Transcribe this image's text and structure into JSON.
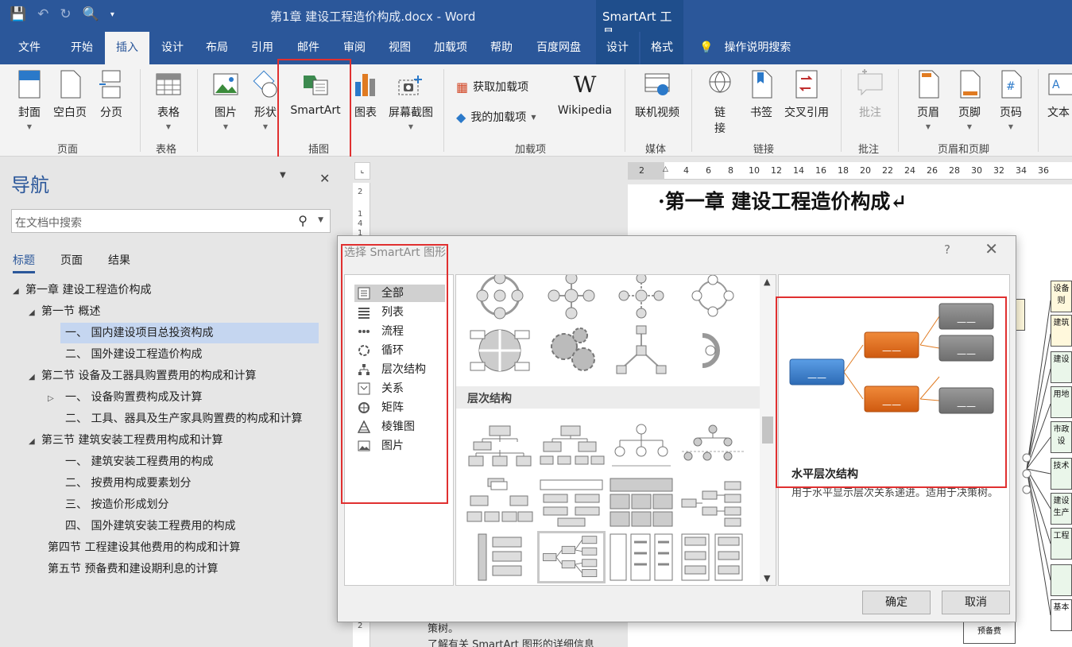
{
  "titlebar": {
    "doc_title": "第1章 建设工程造价构成.docx  -  Word",
    "tools_tab": "SmartArt 工具"
  },
  "tabs": [
    "文件",
    "开始",
    "插入",
    "设计",
    "布局",
    "引用",
    "邮件",
    "审阅",
    "视图",
    "加载项",
    "帮助",
    "百度网盘"
  ],
  "tool_tabs": [
    "设计",
    "格式"
  ],
  "search_tab": "操作说明搜索",
  "ribbon": {
    "page": {
      "cover": "封面",
      "blank": "空白页",
      "break": "分页",
      "group": "页面"
    },
    "table": {
      "table": "表格",
      "group": "表格"
    },
    "illus": {
      "picture": "图片",
      "shapes": "形状",
      "smartart": "SmartArt",
      "chart": "图表",
      "screenshot": "屏幕截图",
      "group": "插图"
    },
    "addins": {
      "get": "获取加载项",
      "mine": "我的加载项",
      "wiki": "Wikipedia",
      "wiki_logo": "W",
      "group": "加载项"
    },
    "media": {
      "video": "联机视频",
      "group": "媒体"
    },
    "links": {
      "link_a": "链",
      "link_b": "接",
      "bookmark": "书签",
      "cross": "交叉引用",
      "group": "链接"
    },
    "comments": {
      "comment": "批注",
      "group": "批注"
    },
    "hf": {
      "header": "页眉",
      "footer": "页脚",
      "pagenum": "页码",
      "group": "页眉和页脚"
    },
    "text": {
      "textbox": "文本"
    }
  },
  "nav": {
    "title": "导航",
    "search_placeholder": "在文档中搜索",
    "tabs": [
      "标题",
      "页面",
      "结果"
    ],
    "items": [
      "第一章 建设工程造价构成",
      "第一节 概述",
      "一、 国内建设项目总投资构成",
      "二、 国外建设工程造价构成",
      "第二节 设备及工器具购置费用的构成和计算",
      "一、 设备购置费构成及计算",
      "二、 工具、器具及生产家具购置费的构成和计算",
      "第三节 建筑安装工程费用构成和计算",
      "一、 建筑安装工程费用的构成",
      "二、 按费用构成要素划分",
      "三、 按造价形成划分",
      "四、 国外建筑安装工程费用的构成",
      "第四节 工程建设其他费用的构成和计算",
      "第五节 预备费和建设期利息的计算"
    ]
  },
  "ruler": {
    "h": [
      "2",
      "2",
      "4",
      "6",
      "8",
      "10",
      "12",
      "14",
      "16",
      "18",
      "20",
      "22",
      "24",
      "26",
      "28",
      "30",
      "32",
      "34",
      "36"
    ],
    "v": [
      "2",
      "1",
      "4",
      "1",
      "2"
    ]
  },
  "doc": {
    "heading": "·第一章   建设工程造价构成↵",
    "below_1": "策树。",
    "below_2": "了解有关 SmartArt 图形的详细信息",
    "chart_boxes": [
      "设备\n则",
      "建筑",
      "建设",
      "用地",
      "市政\n设",
      "技术",
      "建设\n生产",
      "工程",
      "基本",
      "预备费"
    ]
  },
  "dialog": {
    "title": "选择 SmartArt 图形",
    "help": "?",
    "categories": [
      "全部",
      "列表",
      "流程",
      "循环",
      "层次结构",
      "关系",
      "矩阵",
      "棱锥图",
      "图片"
    ],
    "section_head": "层次结构",
    "preview_name": "水平层次结构",
    "preview_desc": "用于水平显示层次关系递进。适用于决策树。",
    "preview_box": "——",
    "ok": "确定",
    "cancel": "取消"
  },
  "colors": {
    "brand": "#2b579a",
    "highlight": "#e03030",
    "blue_box": "#3a7bc8",
    "orange_box": "#e06c1e",
    "gray_box": "#7d7d7d"
  }
}
